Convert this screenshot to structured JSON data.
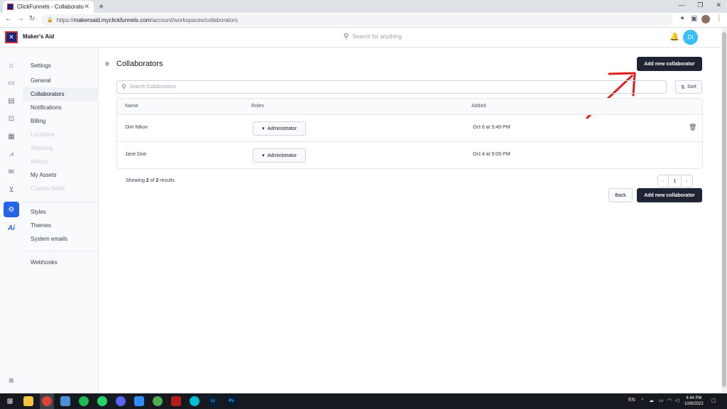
{
  "browser": {
    "tab_title": "ClickFunnels - Collaborators",
    "tab_close": "✕",
    "new_tab": "+",
    "url_host": "makersaid.myclickfunnels.com",
    "url_path": "/account/workspaces/collaborators",
    "url_scheme": "https://",
    "window_controls": [
      "—",
      "❐",
      "✕"
    ]
  },
  "header": {
    "brand": "Maker's Aid",
    "search_placeholder": "Search for anything",
    "avatar_initials": "DI"
  },
  "rail_icons": [
    "home-icon",
    "store-icon",
    "calendar-icon",
    "cart-icon",
    "contact-card-icon",
    "analytics-icon",
    "mail-icon",
    "funnel-icon",
    "settings-icon",
    "ai-icon"
  ],
  "rail_ai_label": "Ai",
  "settings_nav": {
    "heading": "Settings",
    "group1": [
      {
        "label": "General",
        "state": "normal"
      },
      {
        "label": "Collaborators",
        "state": "selected"
      },
      {
        "label": "Notifications",
        "state": "normal"
      },
      {
        "label": "Billing",
        "state": "normal"
      },
      {
        "label": "Locations",
        "state": "disabled"
      },
      {
        "label": "Shipping",
        "state": "disabled"
      },
      {
        "label": "History",
        "state": "disabled"
      },
      {
        "label": "My Assets",
        "state": "normal"
      },
      {
        "label": "Custom fields",
        "state": "disabled"
      }
    ],
    "group2": [
      {
        "label": "Styles"
      },
      {
        "label": "Themes"
      },
      {
        "label": "System emails"
      }
    ],
    "group3": [
      {
        "label": "Webhooks"
      }
    ]
  },
  "main": {
    "title": "Collaborators",
    "add_button": "Add new collaborator",
    "search_placeholder": "Search Collaborators",
    "sort_label": "Sort",
    "columns": [
      "Name",
      "Roles",
      "Added"
    ],
    "rows": [
      {
        "name": "Dim Nikov",
        "role": "Administrator",
        "added": "Oct 6 at 5:49 PM",
        "deletable": true
      },
      {
        "name": "Jane Doe",
        "role": "Administrator",
        "added": "Oct 4 at 9:09 PM",
        "deletable": false
      }
    ],
    "showing_prefix": "Showing ",
    "showing_count": "2",
    "showing_mid": " of ",
    "showing_total": "2",
    "showing_suffix": " results",
    "pager": {
      "prev": "‹",
      "current": "1",
      "next": "›"
    },
    "back_button": "Back",
    "add_button_bottom": "Add new collaborator"
  },
  "annotation": {
    "color": "#e11d1d"
  },
  "taskbar": {
    "lang": "EN",
    "time": "4:44 PM",
    "date": "10/8/2022"
  }
}
